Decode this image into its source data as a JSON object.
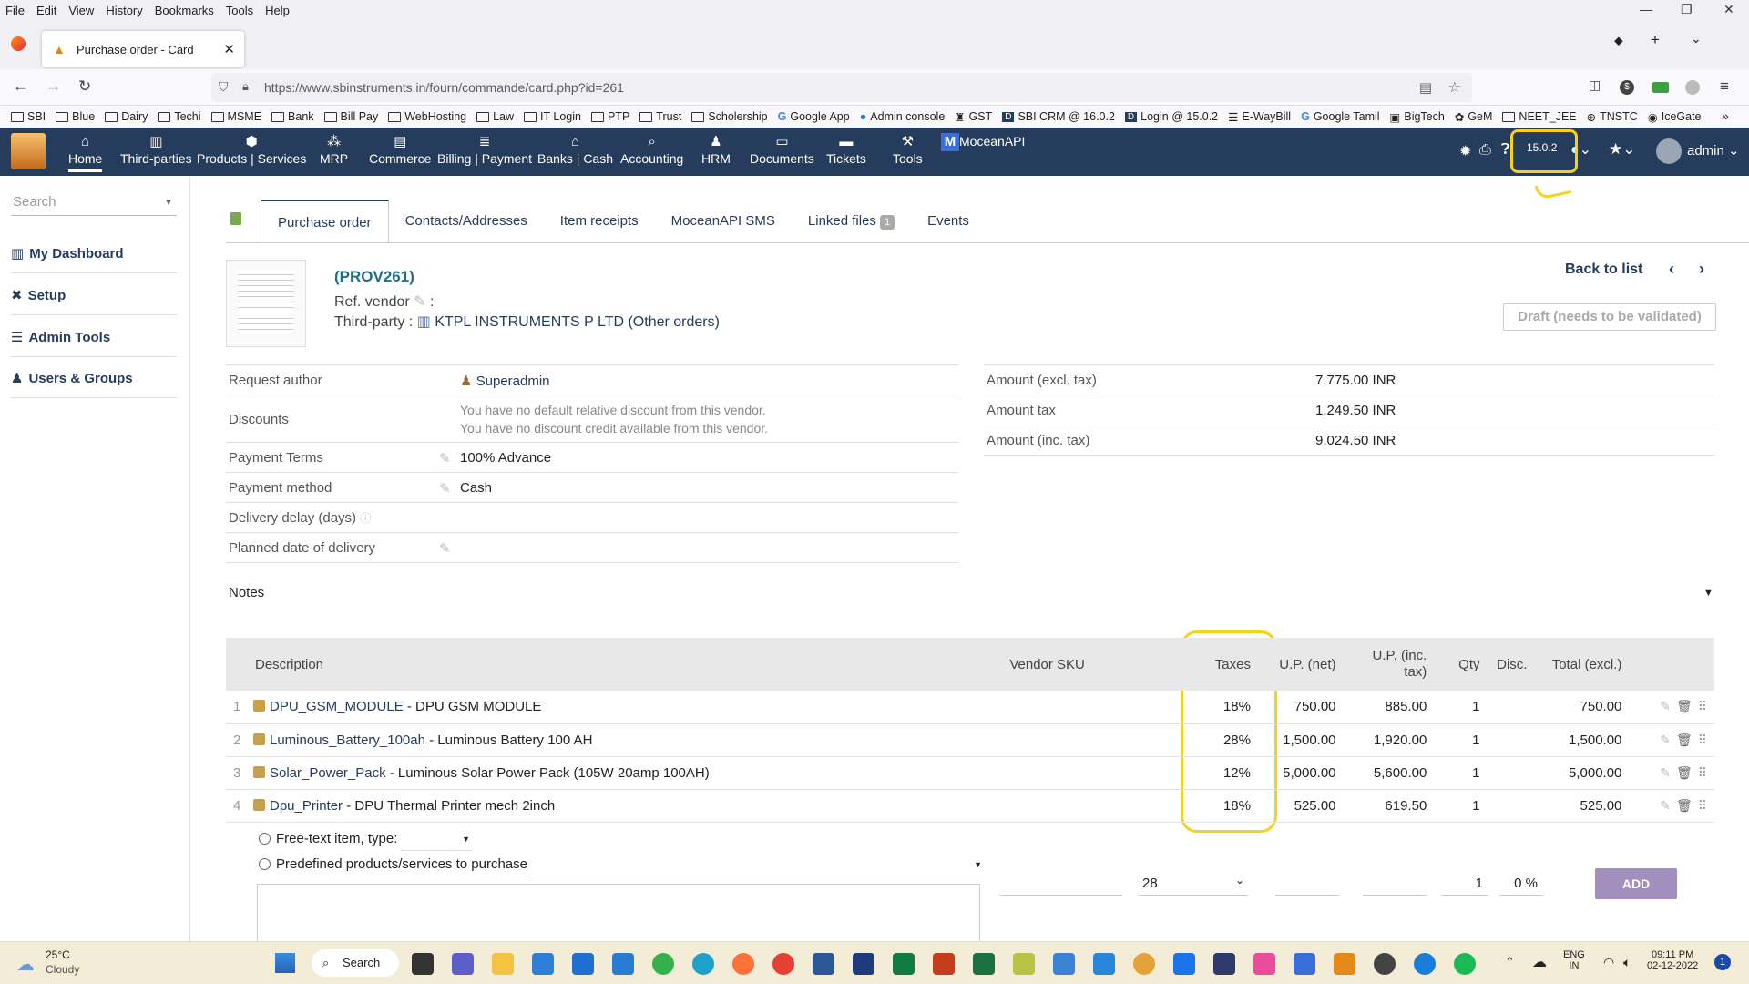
{
  "browser": {
    "menu": [
      "File",
      "Edit",
      "View",
      "History",
      "Bookmarks",
      "Tools",
      "Help"
    ],
    "tab_title": "Purchase order - Card",
    "url": "https://www.sbinstruments.in/fourn/commande/card.php?id=261",
    "bookmarks": [
      "SBI",
      "Blue",
      "Dairy",
      "Techi",
      "MSME",
      "Bank",
      "Bill Pay",
      "WebHosting",
      "Law",
      "IT Login",
      "PTP",
      "Trust",
      "Scholership",
      "Google App",
      "Admin console",
      "GST",
      "SBI CRM @ 16.0.2",
      "Login @ 15.0.2",
      "E-WayBill",
      "Google Tamil",
      "BigTech",
      "GeM",
      "NEET_JEE",
      "TNSTC",
      "IceGate"
    ]
  },
  "appnav": {
    "items": [
      "Home",
      "Third-parties",
      "Products | Services",
      "MRP",
      "Commerce",
      "Billing | Payment",
      "Banks | Cash",
      "Accounting",
      "HRM",
      "Documents",
      "Tickets",
      "Tools",
      "MoceanAPI"
    ],
    "version": "15.0.2",
    "user": "admin"
  },
  "sidebar": {
    "search_placeholder": "Search",
    "items": [
      "My Dashboard",
      "Setup",
      "Admin Tools",
      "Users & Groups"
    ]
  },
  "tabs": [
    "Purchase order",
    "Contacts/Addresses",
    "Item receipts",
    "MoceanAPI SMS",
    "Linked files",
    "Events"
  ],
  "linked_files_count": "1",
  "order": {
    "ref": "(PROV261)",
    "ref_vendor_label": "Ref. vendor",
    "thirdparty_label": "Third-party :",
    "thirdparty": "KTPL INSTRUMENTS P LTD",
    "other_orders": "(Other orders)",
    "back_to_list": "Back to list",
    "status": "Draft (needs to be validated)"
  },
  "fields": {
    "request_author_label": "Request author",
    "request_author": "Superadmin",
    "discounts_label": "Discounts",
    "discount_line1": "You have no default relative discount from this vendor.",
    "discount_line2": "You have no discount credit available from this vendor.",
    "payment_terms_label": "Payment Terms",
    "payment_terms": "100% Advance",
    "payment_method_label": "Payment method",
    "payment_method": "Cash",
    "delivery_delay_label": "Delivery delay (days)",
    "planned_date_label": "Planned date of delivery"
  },
  "amounts": {
    "excl_label": "Amount (excl. tax)",
    "excl": "7,775.00 INR",
    "tax_label": "Amount tax",
    "tax": "1,249.50 INR",
    "inc_label": "Amount (inc. tax)",
    "inc": "9,024.50 INR"
  },
  "notes_label": "Notes",
  "lines": {
    "headers": {
      "description": "Description",
      "vendor_sku": "Vendor SKU",
      "taxes": "Taxes",
      "up_net": "U.P. (net)",
      "up_inc": "U.P. (inc. tax)",
      "qty": "Qty",
      "disc": "Disc.",
      "total": "Total (excl.)"
    },
    "rows": [
      {
        "num": "1",
        "code": "DPU_GSM_MODULE",
        "label": " - DPU GSM MODULE",
        "tax": "18%",
        "up_net": "750.00",
        "up_inc": "885.00",
        "qty": "1",
        "total": "750.00"
      },
      {
        "num": "2",
        "code": "Luminous_Battery_100ah",
        "label": " - Luminous Battery 100 AH",
        "tax": "28%",
        "up_net": "1,500.00",
        "up_inc": "1,920.00",
        "qty": "1",
        "total": "1,500.00"
      },
      {
        "num": "3",
        "code": "Solar_Power_Pack",
        "label": " - Luminous Solar Power Pack (105W 20amp 100AH)",
        "tax": "12%",
        "up_net": "5,000.00",
        "up_inc": "5,600.00",
        "qty": "1",
        "total": "5,000.00"
      },
      {
        "num": "4",
        "code": "Dpu_Printer",
        "label": " - DPU Thermal Printer mech 2inch",
        "tax": "18%",
        "up_net": "525.00",
        "up_inc": "619.50",
        "qty": "1",
        "total": "525.00"
      }
    ]
  },
  "addline": {
    "free_text_label": "Free-text item, type:",
    "predefined_label": "Predefined products/services to purchase",
    "tax_value": "28",
    "qty_value": "1",
    "disc_value": "0 %",
    "add_button": "ADD"
  },
  "taskbar": {
    "weather_temp": "25°C",
    "weather_desc": "Cloudy",
    "search": "Search",
    "lang1": "ENG",
    "lang2": "IN",
    "time": "09:11 PM",
    "date": "02-12-2022",
    "notif_count": "1"
  },
  "colors": {
    "nav_bg": "#263c5c",
    "highlight": "#f5d21c",
    "add_button": "#a38fbd"
  }
}
